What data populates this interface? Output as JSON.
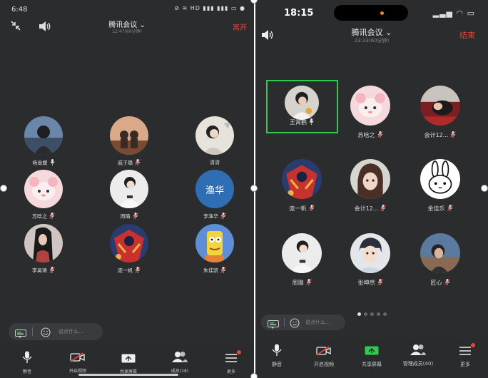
{
  "left": {
    "status": {
      "time": "6:48",
      "icons": "⊘ ≋ HD ▮▮▮ ▮▮▮ ▭ ●"
    },
    "header": {
      "title": "腾讯会议 ⌄",
      "subtitle": "12:47(60分钟)",
      "end": "离开"
    },
    "participants": [
      {
        "name": "杨金媛",
        "mic": "on"
      },
      {
        "name": "戚子璐",
        "mic": "muted"
      },
      {
        "name": "清清",
        "mic": ""
      },
      {
        "name": "苏晗之",
        "mic": "muted"
      },
      {
        "name": "周璐",
        "mic": "muted"
      },
      {
        "name": "李渔华",
        "mic": "muted"
      },
      {
        "name": "李昊璘",
        "mic": "muted"
      },
      {
        "name": "庞一帆",
        "mic": "muted"
      },
      {
        "name": "朱佳凯",
        "mic": "muted"
      }
    ],
    "avatar_badge": "渔华",
    "chat_placeholder": "说点什么...",
    "toolbar": [
      {
        "label": "静音",
        "icon": "mic-icon"
      },
      {
        "label": "开启视频",
        "icon": "video-off-icon"
      },
      {
        "label": "共享屏幕",
        "icon": "share-screen-icon"
      },
      {
        "label": "成员(18)",
        "icon": "members-icon"
      },
      {
        "label": "更多",
        "icon": "more-icon"
      }
    ]
  },
  "right": {
    "status": {
      "time": "18:15",
      "icons": "▂▃▅ ◠ ▭"
    },
    "header": {
      "title": "腾讯会议 ⌄",
      "subtitle": "23:33(60分钟)",
      "end": "结束"
    },
    "participants": [
      {
        "name": "王霄鹤",
        "mic": "on",
        "active": true
      },
      {
        "name": "苏晗之",
        "mic": "muted"
      },
      {
        "name": "会计12...",
        "mic": "muted"
      },
      {
        "name": "庞一帆",
        "mic": "muted"
      },
      {
        "name": "会计12...",
        "mic": "muted"
      },
      {
        "name": "金佳乐",
        "mic": "muted"
      },
      {
        "name": "周璐",
        "mic": "muted"
      },
      {
        "name": "张坤然",
        "mic": "muted"
      },
      {
        "name": "匠心",
        "mic": "muted"
      }
    ],
    "chat_placeholder": "说点什么...",
    "toolbar": [
      {
        "label": "静音",
        "icon": "mic-icon"
      },
      {
        "label": "开启视频",
        "icon": "video-off-icon"
      },
      {
        "label": "共享屏幕",
        "icon": "share-screen-icon"
      },
      {
        "label": "管理成员(40)",
        "icon": "members-icon"
      },
      {
        "label": "更多",
        "icon": "more-icon"
      }
    ]
  },
  "colors": {
    "background": "#2b2c2e",
    "end": "#e8443a",
    "active_speaker": "#2fcb4f",
    "share": "#2fcb4f",
    "video_off": "#e8443a"
  }
}
